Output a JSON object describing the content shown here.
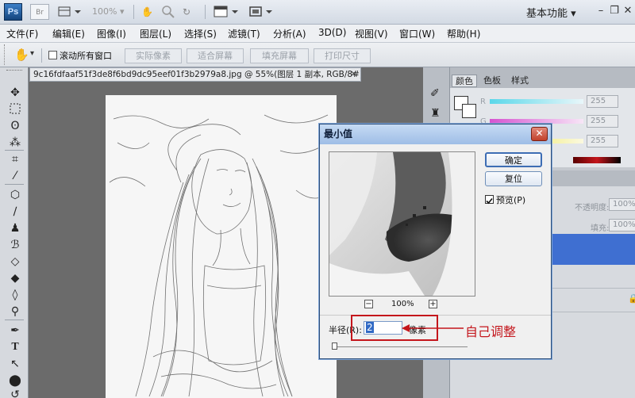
{
  "titlebar": {
    "app_logo": "Ps",
    "zoom_level": "100%",
    "workspace": "基本功能",
    "icons": [
      "br-icon",
      "view-extras-icon",
      "hand-icon",
      "zoom-icon",
      "rotate-icon",
      "arrange-icon",
      "screen-mode-icon"
    ]
  },
  "menubar": {
    "items": [
      "文件(F)",
      "编辑(E)",
      "图像(I)",
      "图层(L)",
      "选择(S)",
      "滤镜(T)",
      "分析(A)",
      "3D(D)",
      "视图(V)",
      "窗口(W)",
      "帮助(H)"
    ]
  },
  "options": {
    "scroll_all": "滚动所有窗口",
    "buttons": [
      "实际像素",
      "适合屏幕",
      "填充屏幕",
      "打印尺寸"
    ]
  },
  "document": {
    "tab_title": "9c16fdfaaf51f3de8f6bd9dc95eef01f3b2979a8.jpg @ 55%(图层 1 副本, RGB/8#)",
    "modified_mark": "*",
    "close": "×"
  },
  "right_panel": {
    "tabs": [
      "颜色",
      "色板",
      "样式"
    ],
    "channels": [
      {
        "label": "R",
        "value": "255"
      },
      {
        "label": "G",
        "value": "255"
      },
      {
        "label": "B",
        "value": "255"
      }
    ],
    "layers": {
      "opacity_label": "不透明度:",
      "opacity_value": "100%",
      "fill_label": "填充:",
      "fill_value": "100%"
    }
  },
  "dialog": {
    "title": "最小值",
    "close": "✕",
    "ok": "确定",
    "reset": "复位",
    "preview_label": "预览(P)",
    "preview_checked": true,
    "zoom": "100%",
    "radius_label": "半径(R):",
    "radius_value": "2",
    "unit": "像素"
  },
  "annotation": "自己调整",
  "colors": {
    "annotation": "#c4161c",
    "titlebar": "#d3dae4",
    "selection": "#316ac5"
  }
}
